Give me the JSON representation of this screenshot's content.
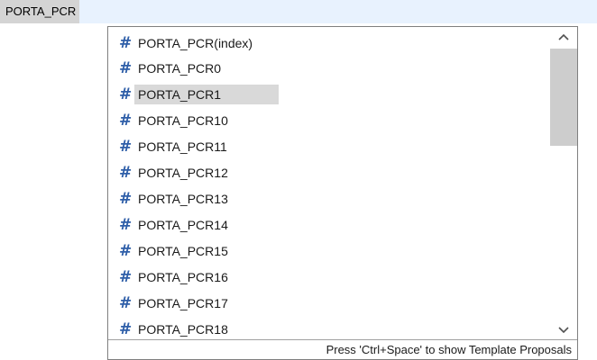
{
  "editor": {
    "typed_text": "PORTA_PCR"
  },
  "popup": {
    "items": [
      {
        "label": "PORTA_PCR(index)",
        "icon": "hash-icon"
      },
      {
        "label": "PORTA_PCR0",
        "icon": "hash-icon"
      },
      {
        "label": "PORTA_PCR1",
        "icon": "hash-icon",
        "selected": true
      },
      {
        "label": "PORTA_PCR10",
        "icon": "hash-icon"
      },
      {
        "label": "PORTA_PCR11",
        "icon": "hash-icon"
      },
      {
        "label": "PORTA_PCR12",
        "icon": "hash-icon"
      },
      {
        "label": "PORTA_PCR13",
        "icon": "hash-icon"
      },
      {
        "label": "PORTA_PCR14",
        "icon": "hash-icon"
      },
      {
        "label": "PORTA_PCR15",
        "icon": "hash-icon"
      },
      {
        "label": "PORTA_PCR16",
        "icon": "hash-icon"
      },
      {
        "label": "PORTA_PCR17",
        "icon": "hash-icon"
      },
      {
        "label": "PORTA_PCR18",
        "icon": "hash-icon"
      }
    ],
    "status": "Press 'Ctrl+Space' to show Template Proposals"
  },
  "colors": {
    "icon": "#2e5ea8",
    "selection": "#d9d9d9",
    "editor_line": "#e8f2fe"
  }
}
